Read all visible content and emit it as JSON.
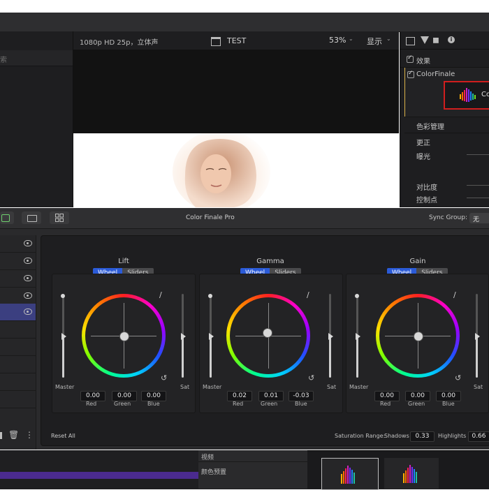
{
  "viewer": {
    "format": "1080p HD 25p，立体声",
    "project": "TEST",
    "zoom": "53%",
    "display": "显示"
  },
  "browser": {
    "search_placeholder": "索"
  },
  "inspector": {
    "section_effects": "效果",
    "plugin_name": "ColorFinale",
    "logo_text": "Co",
    "color_management": "色彩管理",
    "correction": "更正",
    "exposure": "曝光",
    "contrast": "对比度",
    "pivot": "控制点",
    "effects_checked": true,
    "plugin_checked": true
  },
  "panel": {
    "title": "Color Finale Pro",
    "sync_group_label": "Sync Group:",
    "sync_group_value": "无",
    "reset_all": "Reset All",
    "saturation_range_label": "Saturation Range:",
    "shadows_label": "Shadows",
    "shadows_value": "0.33",
    "highlights_label": "Highlights",
    "highlights_value": "0.66",
    "accent_color": "#2b5bd8",
    "selected_layer_color": "#3b3f80",
    "layers_count_visible": 5,
    "selected_layer_index": 4
  },
  "wheels": [
    {
      "title": "Lift",
      "tab_wheel": "Wheel",
      "tab_sliders": "Sliders",
      "master_label": "Master",
      "sat_label": "Sat",
      "red": "0.00",
      "green": "0.00",
      "blue": "0.00",
      "red_label": "Red",
      "green_label": "Green",
      "blue_label": "Blue"
    },
    {
      "title": "Gamma",
      "tab_wheel": "Wheel",
      "tab_sliders": "Sliders",
      "master_label": "Master",
      "sat_label": "Sat",
      "red": "0.02",
      "green": "0.01",
      "blue": "-0.03",
      "red_label": "Red",
      "green_label": "Green",
      "blue_label": "Blue"
    },
    {
      "title": "Gain",
      "tab_wheel": "Wheel",
      "tab_sliders": "Sliders",
      "master_label": "Master",
      "sat_label": "Sat",
      "red": "0.00",
      "green": "0.00",
      "blue": "0.00",
      "red_label": "Red",
      "green_label": "Green",
      "blue_label": "Blue"
    }
  ],
  "bottom": {
    "video": "视频",
    "color_presets": "颜色预置"
  }
}
